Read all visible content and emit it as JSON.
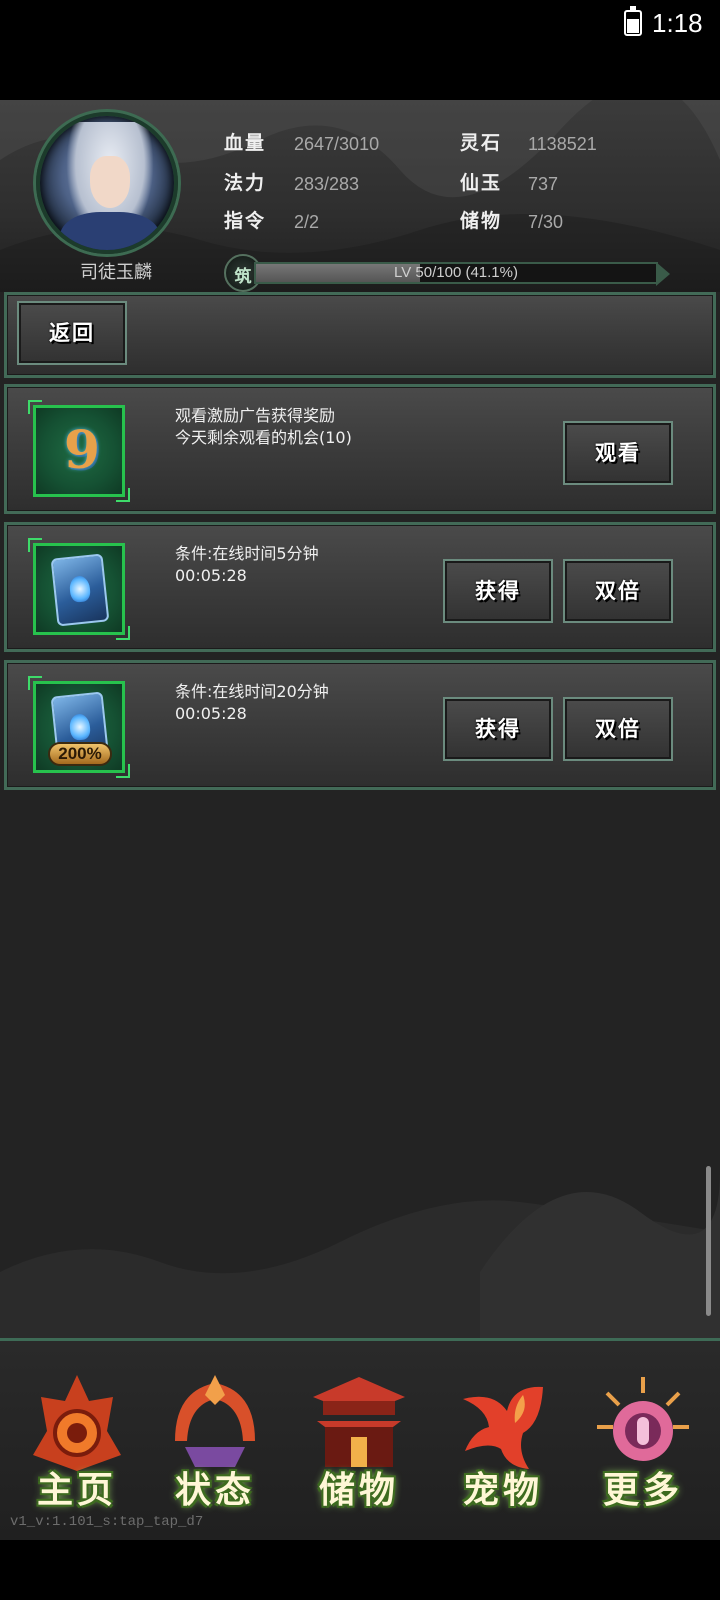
{
  "status_bar": {
    "time": "1:18"
  },
  "character": {
    "name": "司徒玉麟",
    "stats": [
      {
        "label": "血量",
        "value": "2647/3010"
      },
      {
        "label": "灵石",
        "value": "1138521"
      },
      {
        "label": "法力",
        "value": "283/283"
      },
      {
        "label": "仙玉",
        "value": "737"
      },
      {
        "label": "指令",
        "value": "2/2"
      },
      {
        "label": "储物",
        "value": "7/30"
      }
    ],
    "realm_badge": "筑",
    "level_text": "LV 50/100 (41.1%)",
    "level_progress": 0.411
  },
  "back_button": "返回",
  "rewards": [
    {
      "line1": "观看激励广告获得奖励",
      "line2": "今天剩余观看的机会(10)",
      "buttons": [
        "观看"
      ],
      "icon": "nine-ring-icon"
    },
    {
      "line1": "条件:在线时间5分钟",
      "line2": "00:05:28",
      "buttons": [
        "获得",
        "双倍"
      ],
      "icon": "blue-scroll-icon"
    },
    {
      "line1": "条件:在线时间20分钟",
      "line2": "00:05:28",
      "buttons": [
        "获得",
        "双倍"
      ],
      "icon": "blue-scroll-200-icon",
      "badge": "200%"
    }
  ],
  "nav": [
    {
      "label": "主页",
      "icon": "home-emblem-icon",
      "color": "#e0502a"
    },
    {
      "label": "状态",
      "icon": "status-emblem-icon",
      "color": "#d8502a"
    },
    {
      "label": "储物",
      "icon": "storage-pavilion-icon",
      "color": "#c83a2a"
    },
    {
      "label": "宠物",
      "icon": "phoenix-pet-icon",
      "color": "#e2402a"
    },
    {
      "label": "更多",
      "icon": "more-sun-icon",
      "color": "#e06a9a"
    }
  ],
  "version": "v1_v:1.101_s:tap_tap_d7"
}
